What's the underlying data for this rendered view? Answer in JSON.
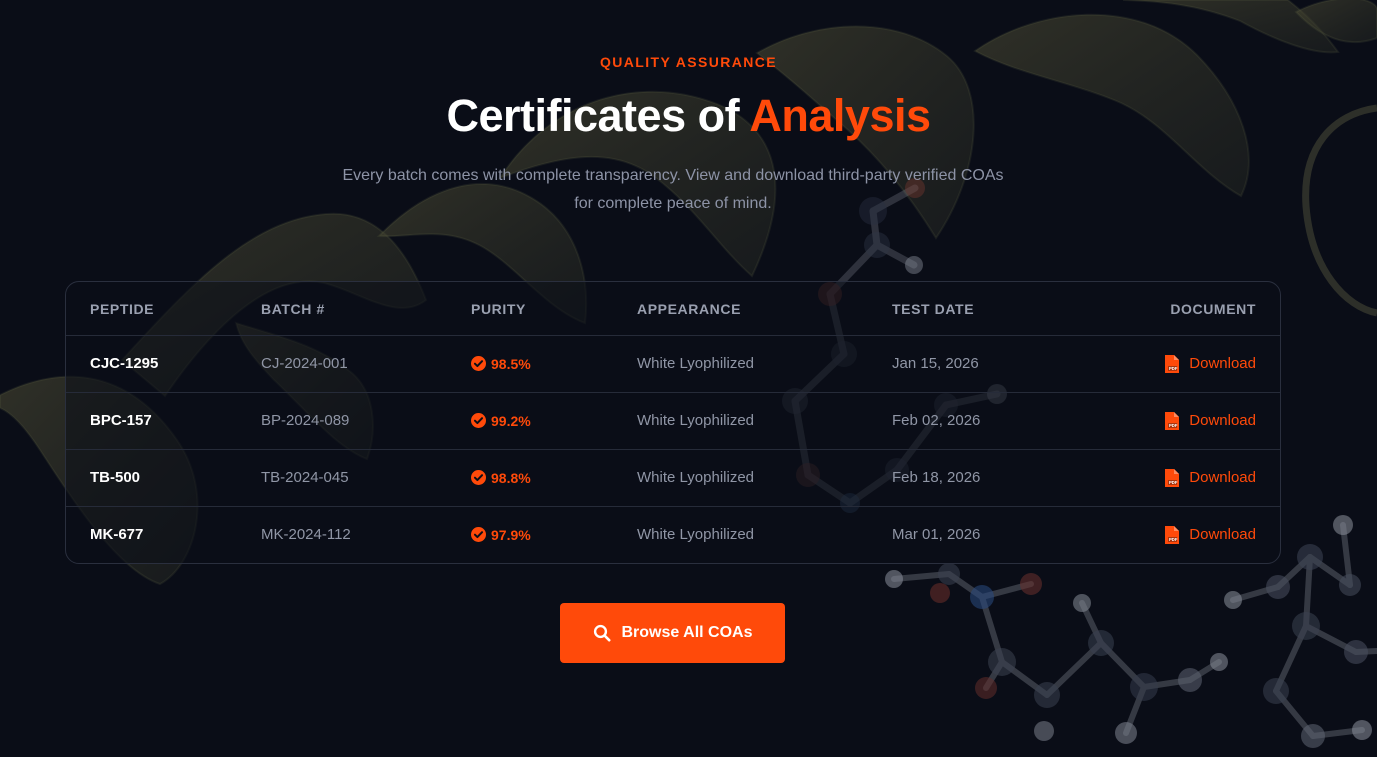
{
  "section": {
    "eyebrow": "QUALITY ASSURANCE",
    "title_main": "Certificates of ",
    "title_accent": "Analysis",
    "subtitle": "Every batch comes with complete transparency. View and download third-party verified COAs for complete peace of mind."
  },
  "table": {
    "headers": {
      "peptide": "PEPTIDE",
      "batch": "BATCH #",
      "purity": "PURITY",
      "appearance": "APPEARANCE",
      "test_date": "TEST DATE",
      "document": "DOCUMENT"
    },
    "rows": [
      {
        "peptide": "CJC-1295",
        "batch": "CJ-2024-001",
        "purity": "98.5%",
        "appearance": "White Lyophilized",
        "test_date": "Jan 15, 2026",
        "document_label": "Download"
      },
      {
        "peptide": "BPC-157",
        "batch": "BP-2024-089",
        "purity": "99.2%",
        "appearance": "White Lyophilized",
        "test_date": "Feb 02, 2026",
        "document_label": "Download"
      },
      {
        "peptide": "TB-500",
        "batch": "TB-2024-045",
        "purity": "98.8%",
        "appearance": "White Lyophilized",
        "test_date": "Feb 18, 2026",
        "document_label": "Download"
      },
      {
        "peptide": "MK-677",
        "batch": "MK-2024-112",
        "purity": "97.9%",
        "appearance": "White Lyophilized",
        "test_date": "Mar 01, 2026",
        "document_label": "Download"
      }
    ]
  },
  "cta": {
    "label": "Browse All COAs",
    "icon": "search-icon"
  },
  "icons": {
    "purity": "check-circle-icon",
    "document": "pdf-file-icon"
  },
  "colors": {
    "background": "#0a0d17",
    "accent": "#ff4a0a",
    "text_primary": "#ffffff",
    "text_muted": "#9096a6",
    "border": "#262b39"
  }
}
